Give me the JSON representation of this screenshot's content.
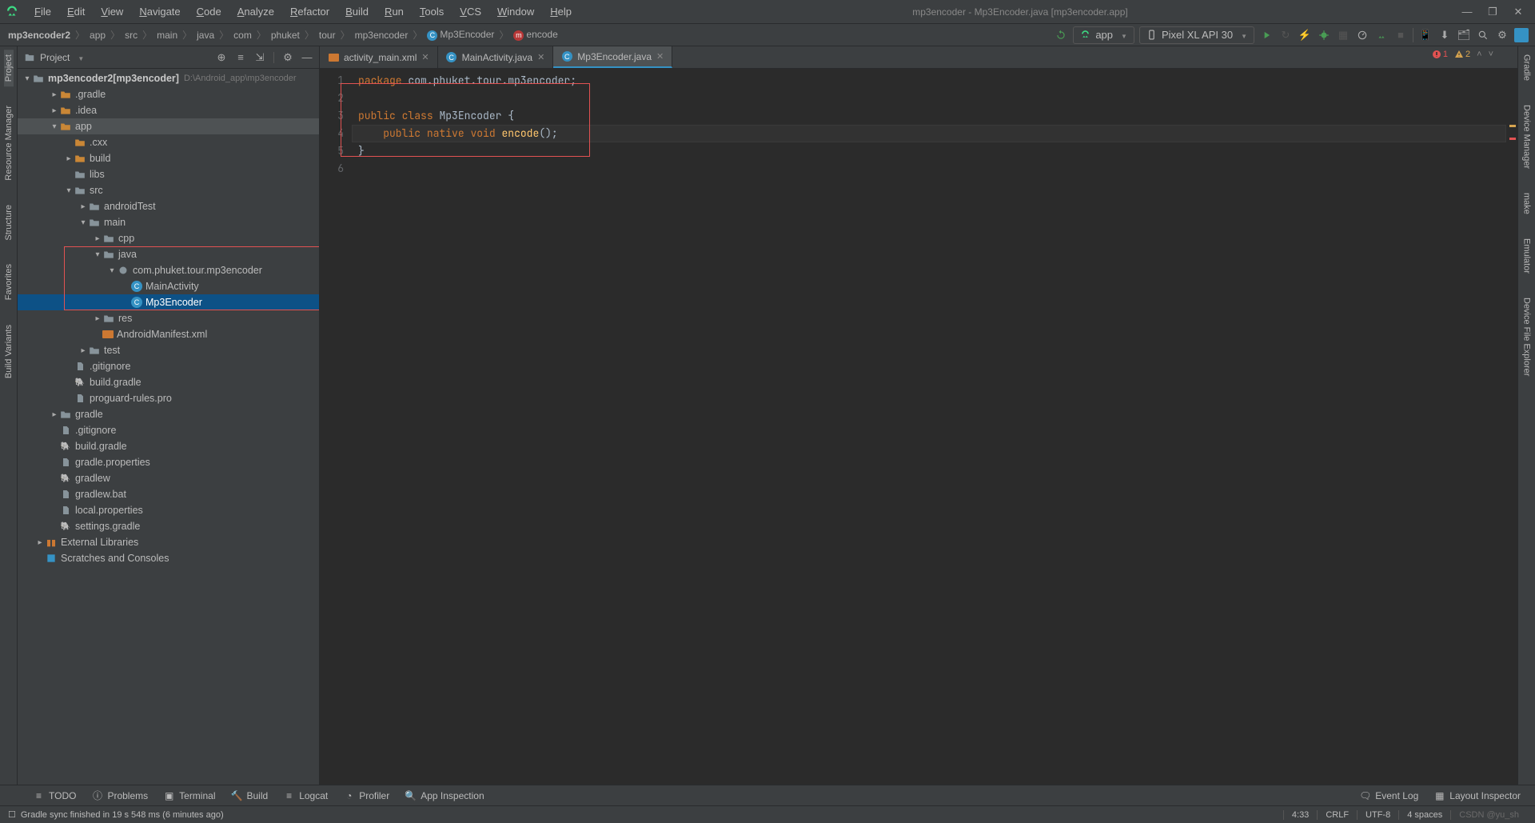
{
  "window_title": "mp3encoder - Mp3Encoder.java [mp3encoder.app]",
  "menu": [
    "File",
    "Edit",
    "View",
    "Navigate",
    "Code",
    "Analyze",
    "Refactor",
    "Build",
    "Run",
    "Tools",
    "VCS",
    "Window",
    "Help"
  ],
  "breadcrumbs": [
    "mp3encoder2",
    "app",
    "src",
    "main",
    "java",
    "com",
    "phuket",
    "tour",
    "mp3encoder",
    "Mp3Encoder",
    "encode"
  ],
  "run_config": "app",
  "device": "Pixel XL API 30",
  "panel": {
    "title": "Project"
  },
  "tree": {
    "root_name": "mp3encoder2",
    "root_target": "[mp3encoder]",
    "root_path": "D:\\Android_app\\mp3encoder",
    "items": [
      {
        "l": 1,
        "n": ".gradle",
        "t": "folder-cfg",
        "a": "r"
      },
      {
        "l": 1,
        "n": ".idea",
        "t": "folder-cfg",
        "a": "r"
      },
      {
        "l": 1,
        "n": "app",
        "t": "folder-cfg",
        "a": "d",
        "hl": 1
      },
      {
        "l": 2,
        "n": ".cxx",
        "t": "folder-cfg"
      },
      {
        "l": 2,
        "n": "build",
        "t": "folder-cfg",
        "a": "r"
      },
      {
        "l": 2,
        "n": "libs",
        "t": "folder"
      },
      {
        "l": 2,
        "n": "src",
        "t": "folder",
        "a": "d"
      },
      {
        "l": 3,
        "n": "androidTest",
        "t": "folder",
        "a": "r"
      },
      {
        "l": 3,
        "n": "main",
        "t": "folder",
        "a": "d"
      },
      {
        "l": 4,
        "n": "cpp",
        "t": "folder",
        "a": "r"
      },
      {
        "l": 4,
        "n": "java",
        "t": "folder-src",
        "a": "d",
        "boxstart": 1
      },
      {
        "l": 5,
        "n": "com.phuket.tour.mp3encoder",
        "t": "pkg",
        "a": "d"
      },
      {
        "l": 6,
        "n": "MainActivity",
        "t": "class"
      },
      {
        "l": 6,
        "n": "Mp3Encoder",
        "t": "class",
        "sel": 1,
        "boxend": 1
      },
      {
        "l": 4,
        "n": "res",
        "t": "folder",
        "a": "r"
      },
      {
        "l": 4,
        "n": "AndroidManifest.xml",
        "t": "xml"
      },
      {
        "l": 3,
        "n": "test",
        "t": "folder",
        "a": "r"
      },
      {
        "l": 2,
        "n": ".gitignore",
        "t": "file"
      },
      {
        "l": 2,
        "n": "build.gradle",
        "t": "gradle"
      },
      {
        "l": 2,
        "n": "proguard-rules.pro",
        "t": "file"
      },
      {
        "l": 1,
        "n": "gradle",
        "t": "folder",
        "a": "r"
      },
      {
        "l": 1,
        "n": ".gitignore",
        "t": "file"
      },
      {
        "l": 1,
        "n": "build.gradle",
        "t": "gradle"
      },
      {
        "l": 1,
        "n": "gradle.properties",
        "t": "file"
      },
      {
        "l": 1,
        "n": "gradlew",
        "t": "gradle"
      },
      {
        "l": 1,
        "n": "gradlew.bat",
        "t": "file"
      },
      {
        "l": 1,
        "n": "local.properties",
        "t": "file"
      },
      {
        "l": 1,
        "n": "settings.gradle",
        "t": "gradle"
      },
      {
        "l": 0,
        "n": "External Libraries",
        "t": "lib",
        "a": "r"
      },
      {
        "l": 0,
        "n": "Scratches and Consoles",
        "t": "scratch"
      }
    ]
  },
  "editor_tabs": [
    {
      "name": "activity_main.xml",
      "ico": "xml"
    },
    {
      "name": "MainActivity.java",
      "ico": "class"
    },
    {
      "name": "Mp3Encoder.java",
      "ico": "class",
      "active": true
    }
  ],
  "code_lines": [
    {
      "n": 1,
      "html": "<span class='kw'>package</span> com.phuket.tour.mp3encoder;"
    },
    {
      "n": 2,
      "html": ""
    },
    {
      "n": 3,
      "html": "<span class='kw'>public</span> <span class='kw'>class</span> <span class='cls'>Mp3Encoder</span> {"
    },
    {
      "n": 4,
      "html": "    <span class='kw'>public</span> <span class='kw'>native</span> <span class='kw'>void</span> <span class='fn'>encode</span>();",
      "cursor": true
    },
    {
      "n": 5,
      "html": "}"
    },
    {
      "n": 6,
      "html": ""
    }
  ],
  "inspection": {
    "errors": "1",
    "warnings": "2"
  },
  "bottom_tabs": [
    "TODO",
    "Problems",
    "Terminal",
    "Build",
    "Logcat",
    "Profiler",
    "App Inspection"
  ],
  "bottom_right": [
    "Event Log",
    "Layout Inspector"
  ],
  "left_tabs": [
    "Project",
    "Resource Manager",
    "Structure",
    "Favorites",
    "Build Variants"
  ],
  "right_tabs": [
    "Gradle",
    "Device Manager",
    "make",
    "Emulator",
    "Device File Explorer"
  ],
  "status": {
    "msg": "Gradle sync finished in 19 s 548 ms (6 minutes ago)",
    "pos": "4:33",
    "eol": "CRLF",
    "enc": "UTF-8",
    "indent": "4 spaces",
    "watermark": "CSDN @yu_sh"
  }
}
